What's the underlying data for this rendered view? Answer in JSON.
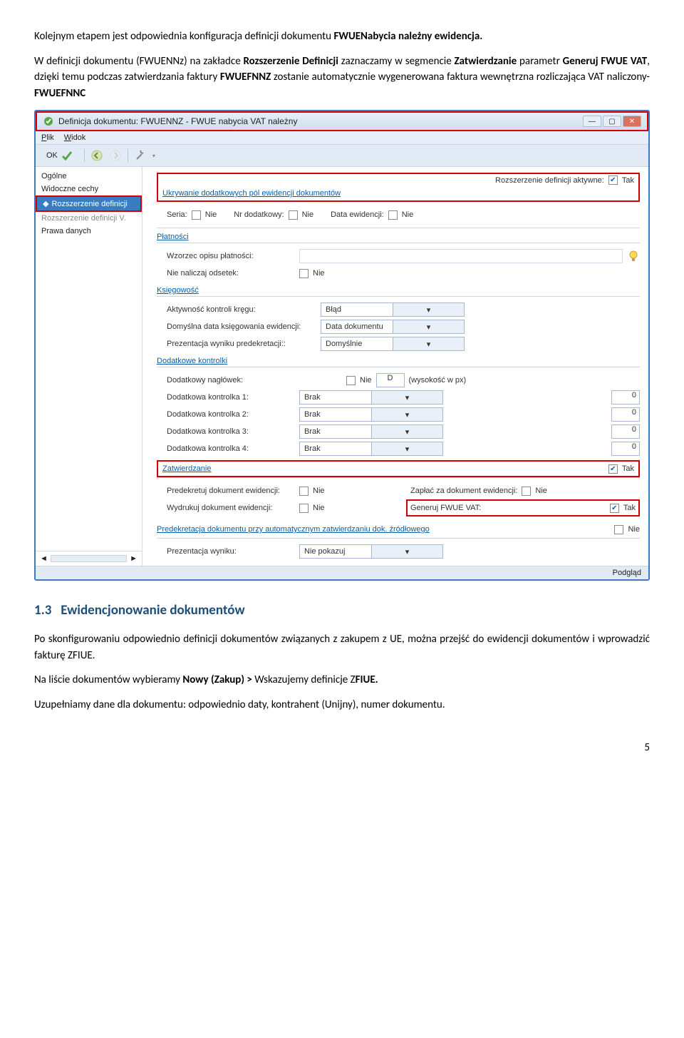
{
  "intro": {
    "p1_a": "Kolejnym etapem jest odpowiednia konfiguracja definicji dokumentu ",
    "p1_b": "FWUENabycia należny ewidencja.",
    "p2_a": "W definicji dokumentu (FWUENNz) na zakładce ",
    "p2_b": "Rozszerzenie Definicji",
    "p2_c": "  zaznaczamy w segmencie ",
    "p2_d": "Zatwierdzanie",
    "p2_e": " parametr ",
    "p2_f": "Generuj FWUE VAT",
    "p2_g": ", dzięki temu podczas zatwierdzania faktury ",
    "p2_h": "FWUEFNNZ",
    "p2_i": " zostanie automatycznie wygenerowana faktura wewnętrzna rozliczająca VAT naliczony- ",
    "p2_j": "FWUEFNNC"
  },
  "window": {
    "title": "Definicja dokumentu: FWUENNZ - FWUE nabycia VAT należny",
    "menus": {
      "plik": "Plik",
      "widok": "Widok"
    },
    "ok": "OK",
    "nav": {
      "n0": "Ogólne",
      "n1": "Widoczne cechy",
      "n2": "Rozszerzenie definicji",
      "n3": "Rozszerzenie definicji V.",
      "n4": "Prawa danych"
    },
    "top": {
      "ext_active_label": "Rozszerzenie definicji aktywne:",
      "ext_active_val": "Tak"
    },
    "hide_group": "Ukrywanie dodatkowych pól ewidencji dokumentów",
    "hide": {
      "seria": "Seria:",
      "seria_v": "Nie",
      "nrdod": "Nr dodatkowy:",
      "nrdod_v": "Nie",
      "dataew": "Data ewidencji:",
      "dataew_v": "Nie"
    },
    "pay_group": "Płatności",
    "pay": {
      "wzorzec": "Wzorzec opisu płatności:",
      "nieodsetek": "Nie naliczaj odsetek:",
      "nieodsetek_v": "Nie"
    },
    "ks_group": "Księgowość",
    "ks": {
      "akt": "Aktywność kontroli kręgu:",
      "akt_v": "Błąd",
      "dom": "Domyślna data księgowania ewidencji:",
      "dom_v": "Data dokumentu",
      "prez": "Prezentacja wyniku predekretacji::",
      "prez_v": "Domyślnie"
    },
    "addctrl_group": "Dodatkowe kontrolki",
    "addctrl": {
      "hdr": "Dodatkowy nagłówek:",
      "hdr_v": "Nie",
      "hdr_d": "D",
      "hdr_hint": "(wysokość w px)",
      "c1": "Dodatkowa kontrolka 1:",
      "c2": "Dodatkowa kontrolka 2:",
      "c3": "Dodatkowa kontrolka 3:",
      "c4": "Dodatkowa kontrolka 4:",
      "brak": "Brak",
      "zero": "0"
    },
    "zat_group": "Zatwierdzanie",
    "zat_v": "Tak",
    "zat": {
      "pred": "Predekretuj dokument ewidencji:",
      "pred_v": "Nie",
      "zap": "Zapłać za dokument ewidencji:",
      "zap_v": "Nie",
      "wyd": "Wydrukuj dokument ewidencji:",
      "wyd_v": "Nie",
      "gen": "Generuj FWUE VAT:",
      "gen_v": "Tak"
    },
    "autopre_group": "Predekretacja dokumentu przy automatycznym zatwierdzaniu dok. źródłowego",
    "autopre_v": "Nie",
    "autopre": {
      "prez": "Prezentacja wyniku:",
      "prez_v": "Nie pokazuj"
    },
    "status": "Podgląd"
  },
  "section": {
    "heading_num": "1.3",
    "heading": "Ewidencjonowanie dokumentów",
    "p1": "Po skonfigurowaniu odpowiednio definicji dokumentów związanych z zakupem z UE, można przejść do ewidencji dokumentów i wprowadzić fakturę ZFIUE.",
    "p2_a": "Na liście dokumentów wybieramy ",
    "p2_b": "Nowy (Zakup) > ",
    "p2_c": "Wskazujemy definicje Z",
    "p2_d": "FIUE.",
    "p3": "Uzupełniamy dane dla dokumentu: odpowiednio daty, kontrahent (Unijny), numer dokumentu."
  },
  "page": "5"
}
